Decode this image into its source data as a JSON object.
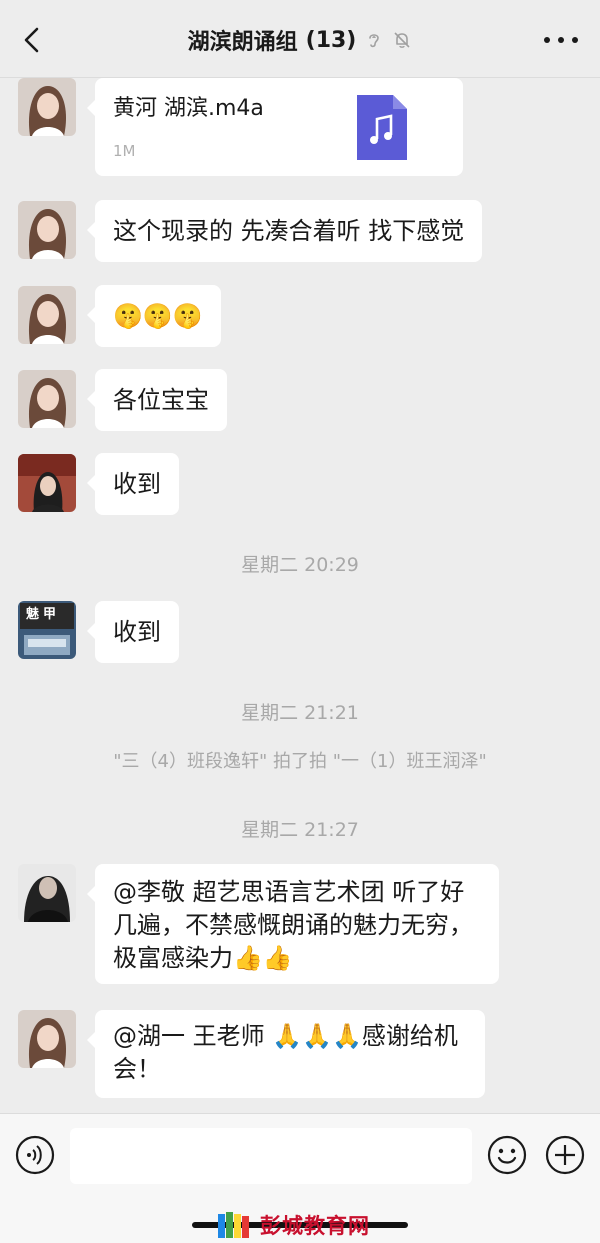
{
  "header": {
    "back_label": "<",
    "title": "湖滨朗诵组",
    "count": "(13)"
  },
  "messages": [
    {
      "type": "file",
      "file_name": "黄河 湖滨.m4a",
      "file_size": "1M"
    },
    {
      "type": "text",
      "text": "这个现录的 先凑合着听 找下感觉"
    },
    {
      "type": "emoji",
      "text": "🤫🤫🤫"
    },
    {
      "type": "text",
      "text": "各位宝宝"
    },
    {
      "type": "text",
      "text": "收到"
    },
    {
      "type": "text",
      "text": "收到"
    },
    {
      "type": "text",
      "text": "@李敬 超艺思语言艺术团 听了好几遍，不禁感慨朗诵的魅力无穷，极富感染力👍👍"
    },
    {
      "type": "text",
      "text": "@湖一 王老师 🙏🙏🙏感谢给机会！"
    }
  ],
  "timestamps": [
    "星期二 20:29",
    "星期二 21:21",
    "星期二 21:27"
  ],
  "system_notice": "\"三（4）班段逸轩\" 拍了拍 \"一（1）班王润泽\"",
  "avatar_text": "魅甲",
  "bottom_bar": {
    "input_value": ""
  },
  "watermark": "彭城教育网",
  "colors": {
    "background": "#ededed",
    "bubble": "#ffffff",
    "file_icon": "#5b5bd6",
    "timestamp": "#a8a8a8"
  },
  "icons": [
    "back-arrow-icon",
    "ear-icon",
    "mute-bell-icon",
    "more-icon",
    "music-note-icon",
    "voice-icon",
    "emoji-icon",
    "plus-icon"
  ]
}
